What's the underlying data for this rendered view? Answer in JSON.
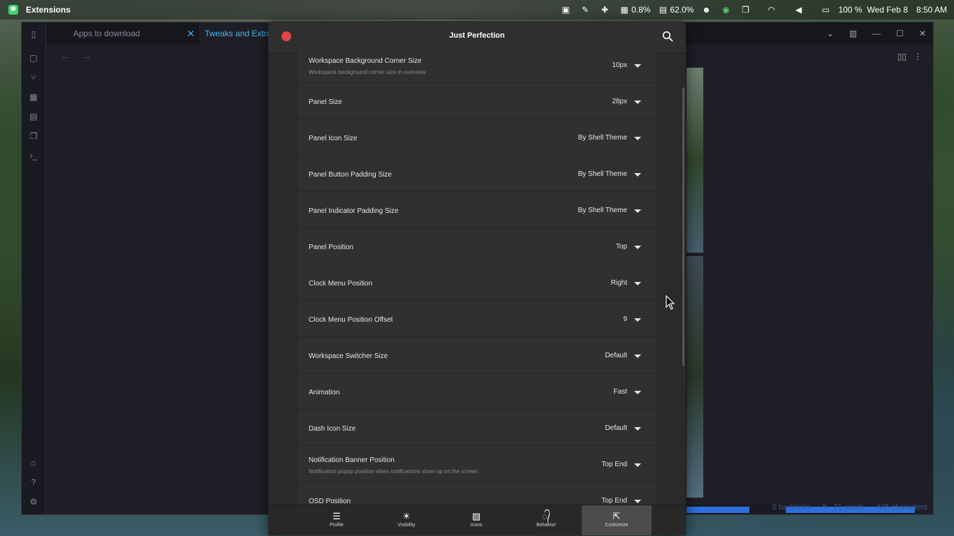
{
  "topbar": {
    "app_name": "Extensions",
    "tray": {
      "cpu": "0.8%",
      "mem": "62.0%",
      "battery": "100 %",
      "date": "Wed Feb 8",
      "time": "8:50 AM"
    }
  },
  "background_window": {
    "tabs": [
      {
        "label": "Apps to download"
      },
      {
        "label": "Tweaks and Extnsions"
      }
    ],
    "status": {
      "backlinks": "0 backlinks",
      "words": "71 words",
      "characters": "645 characters"
    }
  },
  "dialog": {
    "title": "Just Perfection",
    "rows": [
      {
        "label": "Workspace Background Corner Size",
        "subtitle": "Workspace background corner size in overview",
        "value": "10px"
      },
      {
        "label": "Panel Size",
        "subtitle": "",
        "value": "28px"
      },
      {
        "label": "Panel Icon Size",
        "subtitle": "",
        "value": "By Shell Theme"
      },
      {
        "label": "Panel Button Padding Size",
        "subtitle": "",
        "value": "By Shell Theme"
      },
      {
        "label": "Panel Indicator Padding Size",
        "subtitle": "",
        "value": "By Shell Theme"
      },
      {
        "label": "Panel Position",
        "subtitle": "",
        "value": "Top"
      },
      {
        "label": "Clock Menu Position",
        "subtitle": "",
        "value": "Right"
      },
      {
        "label": "Clock Menu Position Offset",
        "subtitle": "",
        "value": "9"
      },
      {
        "label": "Workspace Switcher Size",
        "subtitle": "",
        "value": "Default"
      },
      {
        "label": "Animation",
        "subtitle": "",
        "value": "Fast"
      },
      {
        "label": "Dash Icon Size",
        "subtitle": "",
        "value": "Default"
      },
      {
        "label": "Notification Banner Position",
        "subtitle": "Notification popup position when notifications show up on the screen",
        "value": "Top End"
      },
      {
        "label": "OSD Position",
        "subtitle": "",
        "value": "Top End"
      }
    ],
    "bottom_tabs": [
      {
        "label": "Profile",
        "icon": "list-icon"
      },
      {
        "label": "Visibility",
        "icon": "sun-icon"
      },
      {
        "label": "Icons",
        "icon": "image-icon"
      },
      {
        "label": "Behavior",
        "icon": "snail-icon"
      },
      {
        "label": "Customize",
        "icon": "customize-icon",
        "active": true
      }
    ]
  }
}
